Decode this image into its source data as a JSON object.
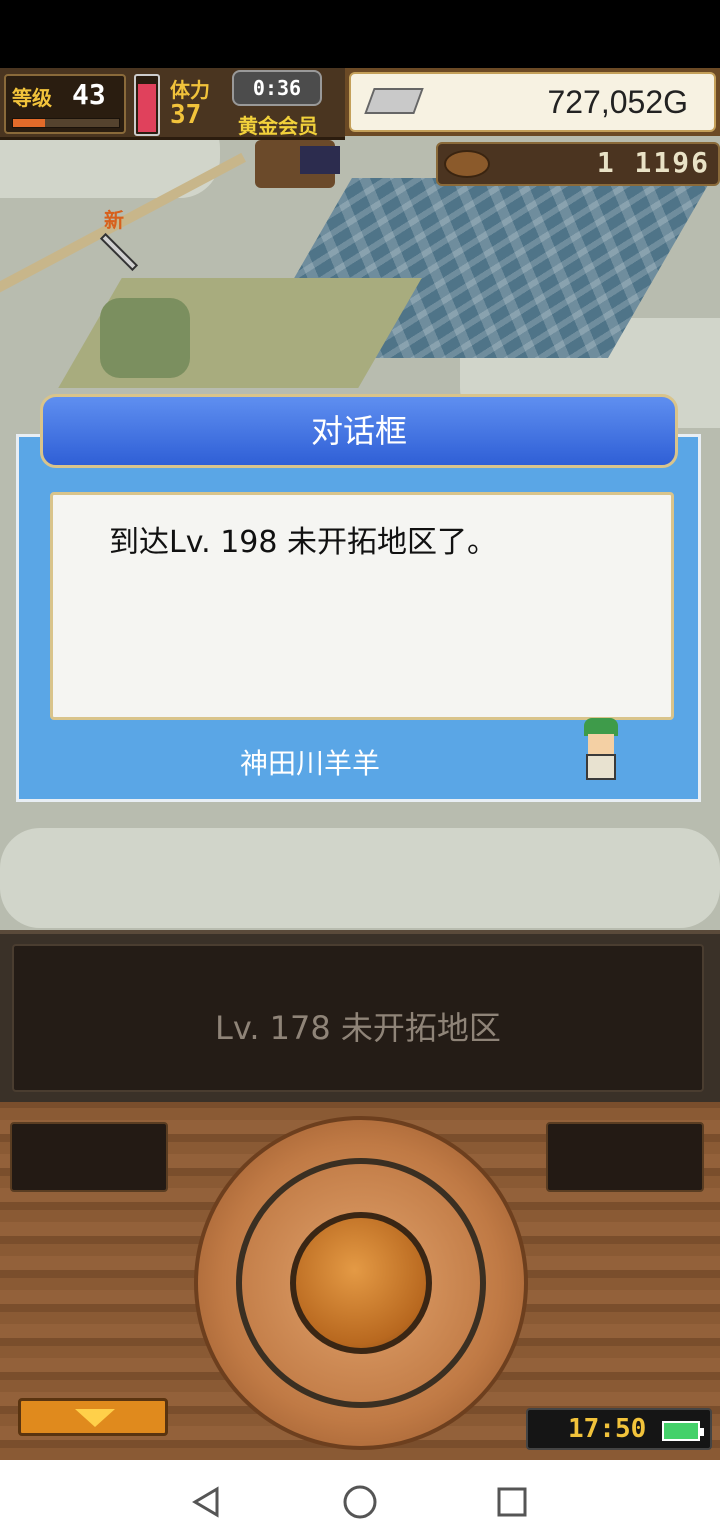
{
  "hud": {
    "level_label": "等级",
    "level": "43",
    "level_progress": 0.3,
    "stamina_label": "体力",
    "stamina": "37",
    "stamina_gauge_fill": 0.9,
    "timer": "0:36",
    "membership": "黄金会员",
    "gold": "727,052G",
    "resource_count": "1 1196"
  },
  "map": {
    "new_marker": "新"
  },
  "dialog": {
    "title": "对话框",
    "message": "到达Lv. 198 未开拓地区了。",
    "speaker": "神田川羊羊"
  },
  "location": {
    "label": "Lv. 178 未开拓地区"
  },
  "controller": {
    "clock": "17:50"
  },
  "colors": {
    "dialog_blue": "#5aa6e6",
    "header_blue": "#2f5fd6",
    "gold_text": "#f2c33b",
    "wood": "#8a5a34"
  },
  "icons": {
    "ingot": "silver-ingot-icon",
    "resource": "coin-bag-icon",
    "battery": "battery-icon",
    "dpad": "dpad-control"
  }
}
